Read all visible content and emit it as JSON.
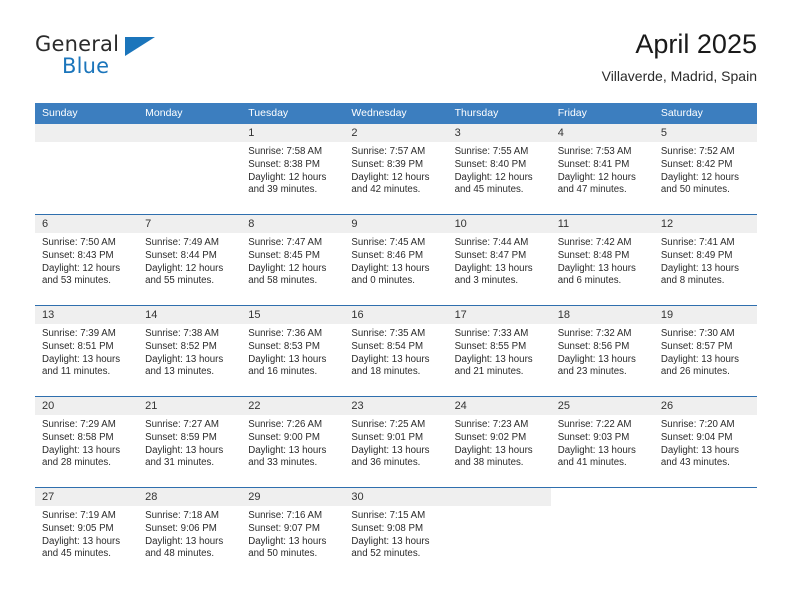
{
  "brand": {
    "name_part1": "General",
    "name_part2": "Blue",
    "accent_color": "#1b75bb"
  },
  "header": {
    "title": "April 2025",
    "subtitle": "Villaverde, Madrid, Spain"
  },
  "calendar": {
    "header_color": "#3c7ebf",
    "weekdays": [
      "Sunday",
      "Monday",
      "Tuesday",
      "Wednesday",
      "Thursday",
      "Friday",
      "Saturday"
    ],
    "weeks": [
      [
        {
          "day": "",
          "blank": true
        },
        {
          "day": "",
          "blank": true
        },
        {
          "day": "1",
          "sunrise": "Sunrise: 7:58 AM",
          "sunset": "Sunset: 8:38 PM",
          "daylight_1": "Daylight: 12 hours",
          "daylight_2": "and 39 minutes."
        },
        {
          "day": "2",
          "sunrise": "Sunrise: 7:57 AM",
          "sunset": "Sunset: 8:39 PM",
          "daylight_1": "Daylight: 12 hours",
          "daylight_2": "and 42 minutes."
        },
        {
          "day": "3",
          "sunrise": "Sunrise: 7:55 AM",
          "sunset": "Sunset: 8:40 PM",
          "daylight_1": "Daylight: 12 hours",
          "daylight_2": "and 45 minutes."
        },
        {
          "day": "4",
          "sunrise": "Sunrise: 7:53 AM",
          "sunset": "Sunset: 8:41 PM",
          "daylight_1": "Daylight: 12 hours",
          "daylight_2": "and 47 minutes."
        },
        {
          "day": "5",
          "sunrise": "Sunrise: 7:52 AM",
          "sunset": "Sunset: 8:42 PM",
          "daylight_1": "Daylight: 12 hours",
          "daylight_2": "and 50 minutes."
        }
      ],
      [
        {
          "day": "6",
          "sunrise": "Sunrise: 7:50 AM",
          "sunset": "Sunset: 8:43 PM",
          "daylight_1": "Daylight: 12 hours",
          "daylight_2": "and 53 minutes."
        },
        {
          "day": "7",
          "sunrise": "Sunrise: 7:49 AM",
          "sunset": "Sunset: 8:44 PM",
          "daylight_1": "Daylight: 12 hours",
          "daylight_2": "and 55 minutes."
        },
        {
          "day": "8",
          "sunrise": "Sunrise: 7:47 AM",
          "sunset": "Sunset: 8:45 PM",
          "daylight_1": "Daylight: 12 hours",
          "daylight_2": "and 58 minutes."
        },
        {
          "day": "9",
          "sunrise": "Sunrise: 7:45 AM",
          "sunset": "Sunset: 8:46 PM",
          "daylight_1": "Daylight: 13 hours",
          "daylight_2": "and 0 minutes."
        },
        {
          "day": "10",
          "sunrise": "Sunrise: 7:44 AM",
          "sunset": "Sunset: 8:47 PM",
          "daylight_1": "Daylight: 13 hours",
          "daylight_2": "and 3 minutes."
        },
        {
          "day": "11",
          "sunrise": "Sunrise: 7:42 AM",
          "sunset": "Sunset: 8:48 PM",
          "daylight_1": "Daylight: 13 hours",
          "daylight_2": "and 6 minutes."
        },
        {
          "day": "12",
          "sunrise": "Sunrise: 7:41 AM",
          "sunset": "Sunset: 8:49 PM",
          "daylight_1": "Daylight: 13 hours",
          "daylight_2": "and 8 minutes."
        }
      ],
      [
        {
          "day": "13",
          "sunrise": "Sunrise: 7:39 AM",
          "sunset": "Sunset: 8:51 PM",
          "daylight_1": "Daylight: 13 hours",
          "daylight_2": "and 11 minutes."
        },
        {
          "day": "14",
          "sunrise": "Sunrise: 7:38 AM",
          "sunset": "Sunset: 8:52 PM",
          "daylight_1": "Daylight: 13 hours",
          "daylight_2": "and 13 minutes."
        },
        {
          "day": "15",
          "sunrise": "Sunrise: 7:36 AM",
          "sunset": "Sunset: 8:53 PM",
          "daylight_1": "Daylight: 13 hours",
          "daylight_2": "and 16 minutes."
        },
        {
          "day": "16",
          "sunrise": "Sunrise: 7:35 AM",
          "sunset": "Sunset: 8:54 PM",
          "daylight_1": "Daylight: 13 hours",
          "daylight_2": "and 18 minutes."
        },
        {
          "day": "17",
          "sunrise": "Sunrise: 7:33 AM",
          "sunset": "Sunset: 8:55 PM",
          "daylight_1": "Daylight: 13 hours",
          "daylight_2": "and 21 minutes."
        },
        {
          "day": "18",
          "sunrise": "Sunrise: 7:32 AM",
          "sunset": "Sunset: 8:56 PM",
          "daylight_1": "Daylight: 13 hours",
          "daylight_2": "and 23 minutes."
        },
        {
          "day": "19",
          "sunrise": "Sunrise: 7:30 AM",
          "sunset": "Sunset: 8:57 PM",
          "daylight_1": "Daylight: 13 hours",
          "daylight_2": "and 26 minutes."
        }
      ],
      [
        {
          "day": "20",
          "sunrise": "Sunrise: 7:29 AM",
          "sunset": "Sunset: 8:58 PM",
          "daylight_1": "Daylight: 13 hours",
          "daylight_2": "and 28 minutes."
        },
        {
          "day": "21",
          "sunrise": "Sunrise: 7:27 AM",
          "sunset": "Sunset: 8:59 PM",
          "daylight_1": "Daylight: 13 hours",
          "daylight_2": "and 31 minutes."
        },
        {
          "day": "22",
          "sunrise": "Sunrise: 7:26 AM",
          "sunset": "Sunset: 9:00 PM",
          "daylight_1": "Daylight: 13 hours",
          "daylight_2": "and 33 minutes."
        },
        {
          "day": "23",
          "sunrise": "Sunrise: 7:25 AM",
          "sunset": "Sunset: 9:01 PM",
          "daylight_1": "Daylight: 13 hours",
          "daylight_2": "and 36 minutes."
        },
        {
          "day": "24",
          "sunrise": "Sunrise: 7:23 AM",
          "sunset": "Sunset: 9:02 PM",
          "daylight_1": "Daylight: 13 hours",
          "daylight_2": "and 38 minutes."
        },
        {
          "day": "25",
          "sunrise": "Sunrise: 7:22 AM",
          "sunset": "Sunset: 9:03 PM",
          "daylight_1": "Daylight: 13 hours",
          "daylight_2": "and 41 minutes."
        },
        {
          "day": "26",
          "sunrise": "Sunrise: 7:20 AM",
          "sunset": "Sunset: 9:04 PM",
          "daylight_1": "Daylight: 13 hours",
          "daylight_2": "and 43 minutes."
        }
      ],
      [
        {
          "day": "27",
          "sunrise": "Sunrise: 7:19 AM",
          "sunset": "Sunset: 9:05 PM",
          "daylight_1": "Daylight: 13 hours",
          "daylight_2": "and 45 minutes."
        },
        {
          "day": "28",
          "sunrise": "Sunrise: 7:18 AM",
          "sunset": "Sunset: 9:06 PM",
          "daylight_1": "Daylight: 13 hours",
          "daylight_2": "and 48 minutes."
        },
        {
          "day": "29",
          "sunrise": "Sunrise: 7:16 AM",
          "sunset": "Sunset: 9:07 PM",
          "daylight_1": "Daylight: 13 hours",
          "daylight_2": "and 50 minutes."
        },
        {
          "day": "30",
          "sunrise": "Sunrise: 7:15 AM",
          "sunset": "Sunset: 9:08 PM",
          "daylight_1": "Daylight: 13 hours",
          "daylight_2": "and 52 minutes."
        },
        {
          "day": "",
          "blank": true
        },
        {
          "day": "",
          "void": true
        },
        {
          "day": "",
          "void": true
        }
      ]
    ]
  }
}
